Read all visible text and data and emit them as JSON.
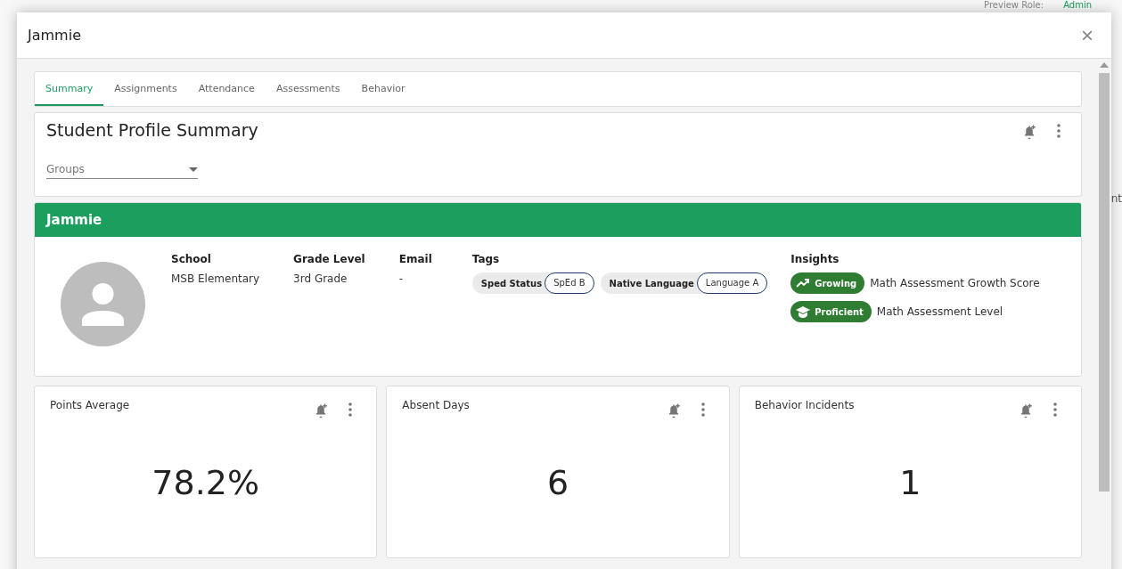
{
  "background": {
    "role_label": "Preview Role:",
    "role_value": "Admin",
    "side_text": "nt"
  },
  "dialog": {
    "title": "Jammie",
    "close": "×"
  },
  "tabs": [
    {
      "label": "Summary",
      "selected": true
    },
    {
      "label": "Assignments",
      "selected": false
    },
    {
      "label": "Attendance",
      "selected": false
    },
    {
      "label": "Assessments",
      "selected": false
    },
    {
      "label": "Behavior",
      "selected": false
    }
  ],
  "summary": {
    "title": "Student Profile Summary",
    "groups_placeholder": "Groups"
  },
  "student": {
    "name": "Jammie",
    "fields": [
      {
        "label": "School",
        "value": "MSB Elementary"
      },
      {
        "label": "Grade Level",
        "value": "3rd Grade"
      },
      {
        "label": "Email",
        "value": "-"
      }
    ],
    "tags_label": "Tags",
    "tags": [
      {
        "name": "Sped Status",
        "value": "SpEd B"
      },
      {
        "name": "Native Language",
        "value": "Language A"
      }
    ],
    "insights_label": "Insights",
    "insights": [
      {
        "kind": "growth",
        "badge": "Growing",
        "text": "Math Assessment Growth Score"
      },
      {
        "kind": "level",
        "badge": "Proficient",
        "text": "Math Assessment Level"
      }
    ]
  },
  "metrics": [
    {
      "title": "Points Average",
      "value": "78.2%"
    },
    {
      "title": "Absent Days",
      "value": "6"
    },
    {
      "title": "Behavior Incidents",
      "value": "1"
    }
  ]
}
